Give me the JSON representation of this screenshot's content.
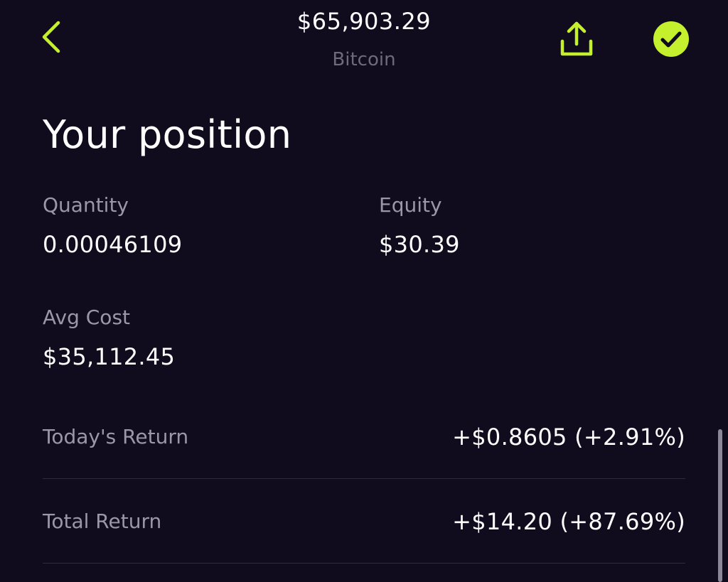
{
  "header": {
    "price": "$65,903.29",
    "asset_name": "Bitcoin",
    "back_icon": "chevron-left-icon",
    "share_icon": "share-upload-icon",
    "check_icon": "check-circle-icon",
    "accent_color": "#c5f02e"
  },
  "position": {
    "title": "Your position",
    "quantity": {
      "label": "Quantity",
      "value": "0.00046109"
    },
    "equity": {
      "label": "Equity",
      "value": "$30.39"
    },
    "avg_cost": {
      "label": "Avg Cost",
      "value": "$35,112.45"
    },
    "todays_return": {
      "label": "Today's Return",
      "value": "+$0.8605 (+2.91%)"
    },
    "total_return": {
      "label": "Total Return",
      "value": "+$14.20 (+87.69%)"
    }
  }
}
